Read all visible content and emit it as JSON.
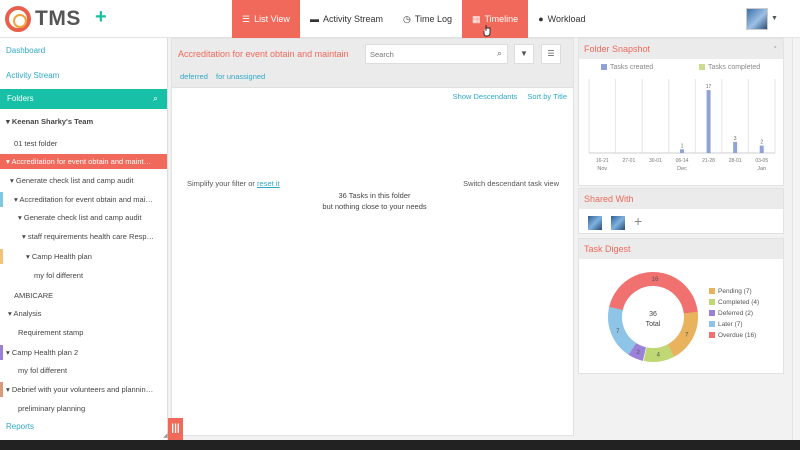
{
  "app": {
    "logo_text": "TMS",
    "add_label": "+"
  },
  "nav": [
    {
      "label": "List View",
      "icon": "list-icon",
      "glyph": "☰",
      "active": true
    },
    {
      "label": "Activity Stream",
      "icon": "comment-icon",
      "glyph": "▬",
      "active": false
    },
    {
      "label": "Time Log",
      "icon": "clock-icon",
      "glyph": "◷",
      "active": false
    },
    {
      "label": "Timeline",
      "icon": "calendar-icon",
      "glyph": "▦",
      "active": true
    },
    {
      "label": "Workload",
      "icon": "user-icon",
      "glyph": "●",
      "active": false
    }
  ],
  "sidebar": {
    "dashboard": "Dashboard",
    "activity_stream": "Activity Stream",
    "folders": "Folders",
    "reports": "Reports",
    "tree": [
      {
        "label": "Keenan Sharky's Team",
        "caret": "▾ ",
        "bold": true,
        "color": ""
      },
      {
        "label": "01 test folder",
        "caret": "",
        "color": ""
      },
      {
        "label": "Accreditation for event obtain and maint…",
        "caret": "▾ ",
        "color": "#f0695a",
        "selected": true
      },
      {
        "label": "Generate check list and camp audit",
        "caret": "▾ ",
        "color": ""
      },
      {
        "label": "Accreditation for event obtain and mai…",
        "caret": "▾ ",
        "color": "#7ec8e3"
      },
      {
        "label": "Generate check list and camp audit",
        "caret": "▾ ",
        "color": ""
      },
      {
        "label": "staff requirements health care Resp…",
        "caret": "▾ ",
        "color": ""
      },
      {
        "label": "Camp Health plan",
        "caret": "▾ ",
        "color": "#f3c27a"
      },
      {
        "label": "my fol different",
        "caret": "",
        "color": ""
      },
      {
        "label": "AMBICARE",
        "caret": "",
        "color": ""
      },
      {
        "label": "Analysis",
        "caret": "▾ ",
        "color": ""
      },
      {
        "label": "Requirement stamp",
        "caret": "",
        "color": ""
      },
      {
        "label": "Camp Health plan 2",
        "caret": "▾ ",
        "color": "#9b7fd4"
      },
      {
        "label": "my fol different",
        "caret": "",
        "color": ""
      },
      {
        "label": "Debrief with your volunteers and plannin…",
        "caret": "▾ ",
        "color": "#d79a7a"
      },
      {
        "label": "preliminary planning",
        "caret": "",
        "color": ""
      }
    ]
  },
  "main": {
    "title": "Accreditation for event obtain and maintain",
    "search_placeholder": "Search",
    "filter_icon": "▼",
    "menu_icon": "☰",
    "tabs": [
      "deferred",
      "for unassigned"
    ],
    "show_descendants": "Show Descendants",
    "sort": "Sort by Title",
    "hint_left_text": "Simplify your filter or ",
    "hint_left_link": "reset it",
    "hint_right": "Switch descendant task view",
    "empty_line1": "36 Tasks in this folder",
    "empty_line2": "but nothing close to your needs",
    "grip": "|||"
  },
  "snapshot": {
    "title": "Folder Snapshot",
    "legend_created": "Tasks created",
    "legend_completed": "Tasks completed",
    "color_created": "#8fa3d9",
    "color_completed": "#c9dd8a",
    "x_labels": [
      "16-21",
      "27-01",
      "30-01",
      "06-14",
      "21-28",
      "28-01",
      "03-05"
    ],
    "months": [
      "Nov",
      "Dec",
      "Jan"
    ],
    "created": [
      0,
      0,
      0,
      1,
      17,
      3,
      2
    ],
    "created_labels": [
      "",
      "",
      "",
      "1",
      "17",
      "3",
      "2"
    ]
  },
  "shared": {
    "title": "Shared With",
    "add": "+"
  },
  "digest": {
    "title": "Task Digest",
    "center_value": "36",
    "center_label": "Total",
    "segments": [
      {
        "name": "Pending",
        "value": 7,
        "color": "#e9b25c",
        "legend": "Pending (7)"
      },
      {
        "name": "Completed",
        "value": 4,
        "color": "#bfd874",
        "legend": "Completed (4)"
      },
      {
        "name": "Deferred",
        "value": 2,
        "color": "#9b82d8",
        "legend": "Deferred (2)"
      },
      {
        "name": "Later",
        "value": 7,
        "color": "#8ec4e6",
        "legend": "Later (7)"
      },
      {
        "name": "Overdue",
        "value": 16,
        "color": "#f17070",
        "legend": "Overdue (16)"
      }
    ],
    "segment_labels": [
      "7",
      "4",
      "2",
      "7",
      "16"
    ]
  }
}
